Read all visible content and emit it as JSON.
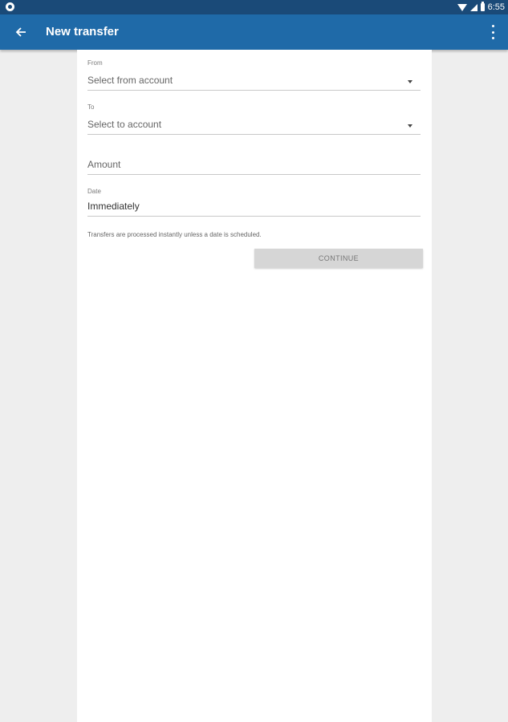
{
  "status_bar": {
    "time": "6:55",
    "icons": [
      "status-dot-icon",
      "wifi-icon",
      "signal-icon",
      "battery-icon"
    ]
  },
  "app_bar": {
    "title": "New transfer",
    "icons": [
      "back-arrow-icon",
      "overflow-menu-icon"
    ],
    "color": "#1f6aa8"
  },
  "form": {
    "from": {
      "label": "From",
      "placeholder": "Select from account"
    },
    "to": {
      "label": "To",
      "placeholder": "Select to account"
    },
    "amount": {
      "placeholder": "Amount"
    },
    "date": {
      "label": "Date",
      "value": "Immediately"
    },
    "helper_text": "Transfers are processed instantly unless a date is scheduled.",
    "continue_label": "CONTINUE"
  }
}
